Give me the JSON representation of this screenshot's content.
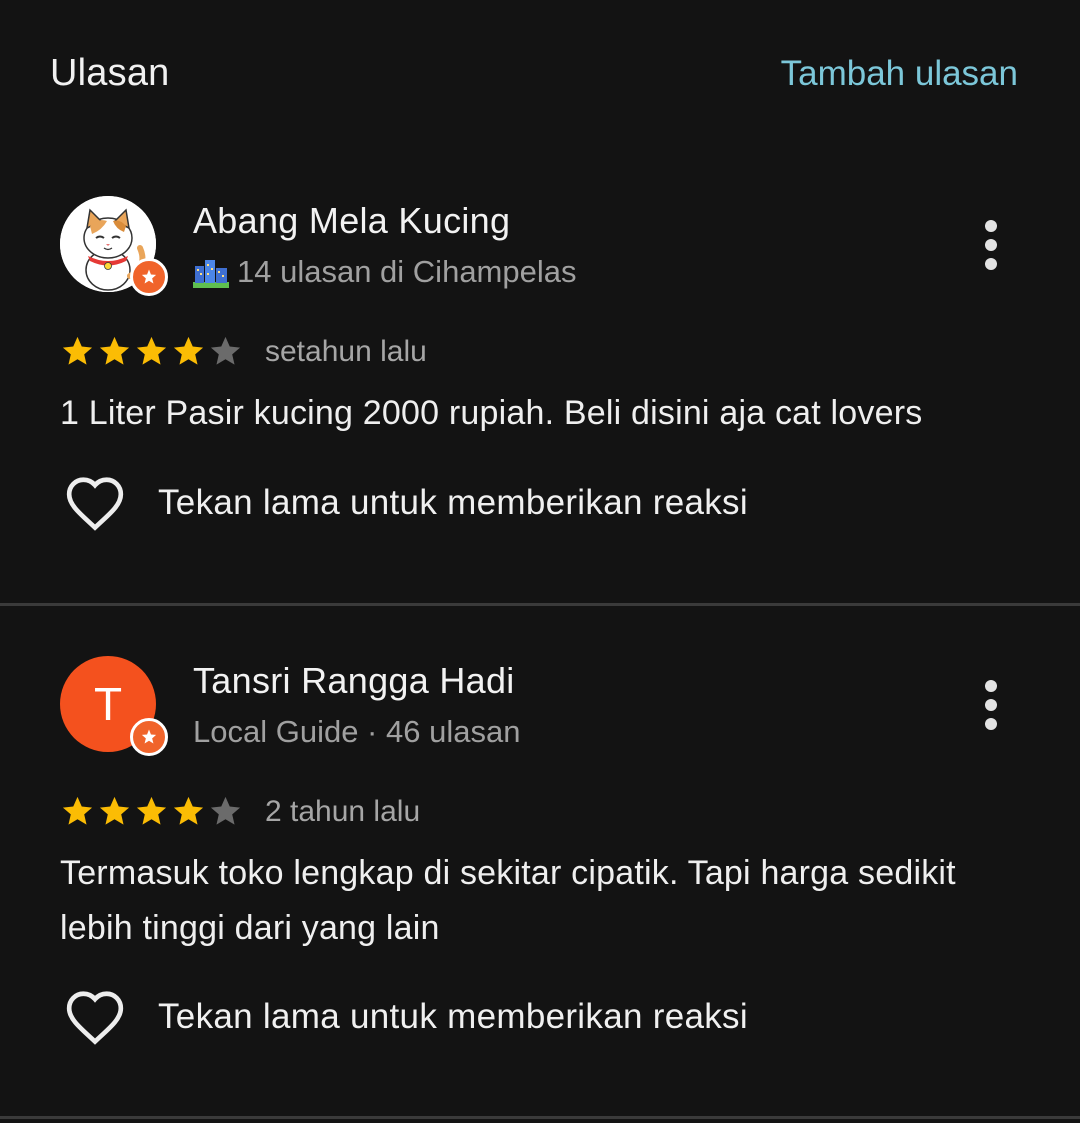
{
  "header": {
    "title": "Ulasan",
    "add_review_label": "Tambah ulasan"
  },
  "colors": {
    "background": "#131313",
    "accent": "#7cc7d9",
    "star_filled": "#fbbc04",
    "star_empty": "#6b6b6b",
    "local_guide_badge": "#f0642b",
    "letter_avatar": "#f4511e"
  },
  "reviews": [
    {
      "reviewer_name": "Abang Mela Kucing",
      "avatar": "cat-avatar",
      "meta_icon": "city-icon",
      "meta_text": "14 ulasan di Cihampelas",
      "rating": 4,
      "max_rating": 5,
      "date": "setahun lalu",
      "text": "1 Liter Pasir kucing 2000 rupiah. Beli disini aja cat lovers",
      "reaction_label": "Tekan lama untuk memberikan reaksi"
    },
    {
      "reviewer_name": "Tansri Rangga Hadi",
      "avatar_letter": "T",
      "meta_text": "Local Guide · 46 ulasan",
      "rating": 4,
      "max_rating": 5,
      "date": "2 tahun lalu",
      "text": "Termasuk toko lengkap di sekitar cipatik. Tapi harga sedikit lebih tinggi dari yang lain",
      "reaction_label": "Tekan lama untuk memberikan reaksi"
    }
  ]
}
